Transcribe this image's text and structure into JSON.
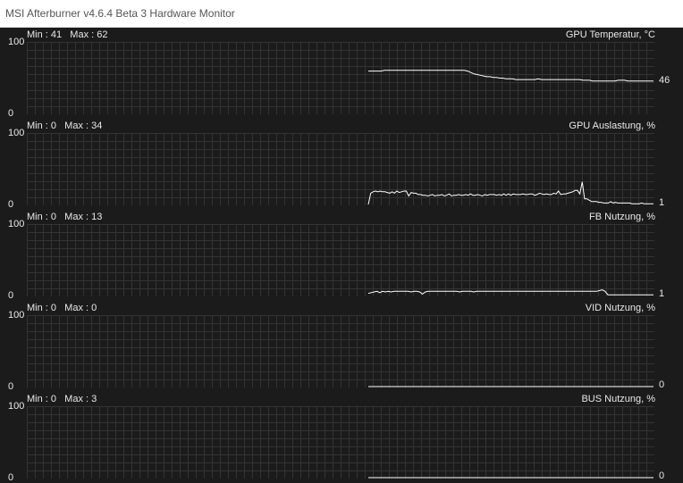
{
  "window": {
    "title": "MSI Afterburner v4.6.4 Beta 3 Hardware Monitor"
  },
  "axis": {
    "max_label": "100",
    "min_label": "0"
  },
  "graphs": [
    {
      "name": "GPU Temperatur, °C",
      "min_max": "Min : 41   Max : 62",
      "current": "46"
    },
    {
      "name": "GPU Auslastung, %",
      "min_max": "Min : 0   Max : 34",
      "current": "1"
    },
    {
      "name": "FB Nutzung, %",
      "min_max": "Min : 0   Max : 13",
      "current": "1"
    },
    {
      "name": "VID Nutzung, %",
      "min_max": "Min : 0   Max : 0",
      "current": "0"
    },
    {
      "name": "BUS Nutzung, %",
      "min_max": "Min : 0   Max : 3",
      "current": "0"
    }
  ],
  "colors": {
    "background": "#1b1b1b",
    "grid": "#333333",
    "line": "#ffffff",
    "text": "#e8e8e8"
  },
  "chart_data": [
    {
      "type": "line",
      "title": "GPU Temperatur, °C",
      "ylim": [
        0,
        100
      ],
      "grid": true,
      "series": [
        {
          "values": [
            60,
            60,
            60,
            60,
            60,
            61,
            61,
            61,
            61,
            61,
            61,
            61,
            61,
            61,
            61,
            61,
            61,
            61,
            61,
            61,
            61,
            61,
            61,
            61,
            61,
            61,
            61,
            61,
            61,
            61,
            61,
            60,
            58,
            56,
            55,
            54,
            53,
            52,
            52,
            51,
            51,
            50,
            50,
            49,
            49,
            49,
            48,
            48,
            48,
            48,
            48,
            48,
            48,
            49,
            48,
            48,
            48,
            48,
            48,
            48,
            48,
            48,
            48,
            48,
            48,
            48,
            48,
            47,
            47,
            47,
            46,
            46,
            46,
            46,
            46,
            46,
            46,
            46,
            47,
            47,
            47,
            46,
            46,
            46,
            46,
            46,
            46,
            46,
            46,
            46
          ]
        }
      ]
    },
    {
      "type": "line",
      "title": "GPU Auslastung, %",
      "ylim": [
        0,
        100
      ],
      "grid": true,
      "series": [
        {
          "values": [
            0,
            16,
            18,
            19,
            18,
            19,
            18,
            18,
            17,
            16,
            18,
            16,
            19,
            17,
            18,
            19,
            19,
            12,
            17,
            16,
            16,
            14,
            14,
            13,
            13,
            12,
            13,
            14,
            12,
            13,
            13,
            14,
            12,
            13,
            15,
            12,
            13,
            13,
            14,
            13,
            13,
            14,
            13,
            15,
            13,
            13,
            14,
            13,
            12,
            14,
            13,
            14,
            14,
            14,
            13,
            14,
            13,
            15,
            13,
            15,
            13,
            15,
            14,
            14,
            14,
            15,
            14,
            14,
            15,
            15,
            13,
            14,
            16,
            15,
            14,
            15,
            14,
            14,
            16,
            15,
            19,
            14,
            15,
            15,
            16,
            17,
            18,
            20,
            20,
            15,
            32,
            8,
            8,
            6,
            4,
            4,
            4,
            3,
            3,
            2,
            2,
            2,
            4,
            2,
            3,
            2,
            2,
            2,
            2,
            2,
            2,
            1,
            1,
            1,
            1,
            2,
            1,
            1,
            1,
            1,
            1
          ]
        }
      ]
    },
    {
      "type": "line",
      "title": "FB Nutzung, %",
      "ylim": [
        0,
        100
      ],
      "grid": true,
      "series": [
        {
          "values": [
            3,
            4,
            5,
            6,
            4,
            6,
            5,
            6,
            5,
            6,
            6,
            6,
            6,
            6,
            6,
            5,
            6,
            6,
            5,
            2,
            5,
            6,
            6,
            6,
            6,
            6,
            6,
            6,
            6,
            6,
            6,
            6,
            5,
            6,
            6,
            6,
            6,
            5,
            6,
            6,
            6,
            6,
            6,
            6,
            6,
            6,
            6,
            6,
            6,
            6,
            6,
            6,
            6,
            6,
            6,
            6,
            6,
            6,
            6,
            6,
            6,
            6,
            6,
            6,
            6,
            6,
            6,
            6,
            6,
            6,
            6,
            6,
            6,
            6,
            6,
            6,
            6,
            6,
            6,
            6,
            6,
            7,
            8,
            6,
            1,
            1,
            1,
            1,
            1,
            1,
            1,
            1,
            1,
            1,
            1,
            1,
            1,
            1,
            1,
            1,
            1
          ]
        }
      ]
    },
    {
      "type": "line",
      "title": "VID Nutzung, %",
      "ylim": [
        0,
        100
      ],
      "grid": true,
      "series": [
        {
          "values": [
            0,
            0,
            0,
            0,
            0,
            0,
            0,
            0,
            0,
            0,
            0,
            0,
            0,
            0,
            0,
            0,
            0,
            0,
            0,
            0,
            0,
            0,
            0,
            0,
            0,
            0,
            0,
            0,
            0,
            0,
            0,
            0,
            0,
            0,
            0,
            0,
            0,
            0,
            0,
            0,
            0
          ]
        }
      ]
    },
    {
      "type": "line",
      "title": "BUS Nutzung, %",
      "ylim": [
        0,
        100
      ],
      "grid": true,
      "series": [
        {
          "values": [
            0,
            0,
            0,
            0,
            0,
            0,
            0,
            0,
            0,
            0,
            0,
            0,
            0,
            0,
            0,
            0,
            0,
            0,
            0,
            0,
            0,
            0,
            0,
            0,
            0,
            0,
            0,
            0,
            0,
            0,
            0,
            0,
            0,
            0,
            0,
            0,
            0,
            0,
            0,
            0,
            0,
            0,
            0,
            0,
            0,
            0,
            0,
            0,
            0,
            0,
            0,
            0,
            0,
            0,
            0,
            0,
            0,
            0,
            0,
            0,
            0,
            0,
            0,
            0,
            0,
            0,
            0,
            0,
            0,
            0,
            0,
            0,
            0,
            0,
            0,
            0,
            0,
            0,
            0,
            0,
            0,
            0,
            0,
            0,
            0,
            0,
            0,
            0,
            0,
            0,
            0,
            0,
            0,
            0,
            0,
            0,
            0,
            0,
            0,
            0,
            0
          ]
        }
      ]
    }
  ]
}
